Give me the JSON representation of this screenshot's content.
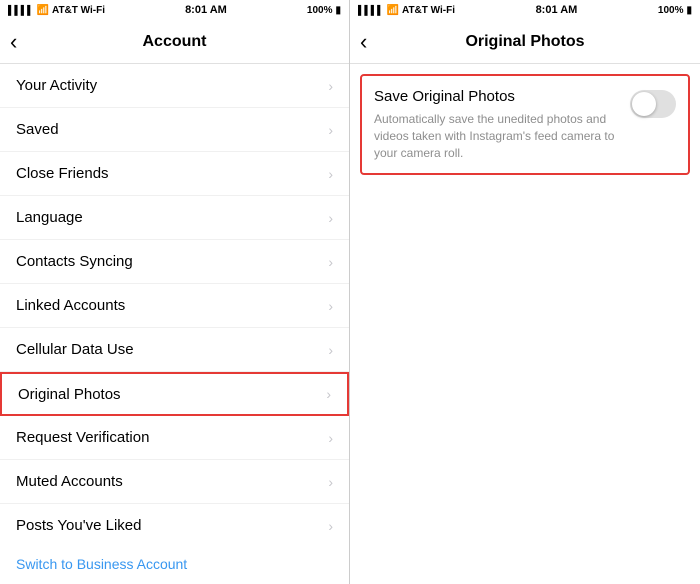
{
  "left": {
    "status": {
      "carrier": "AT&T Wi-Fi",
      "time": "8:01 AM",
      "battery": "100%"
    },
    "nav": {
      "back_label": "‹",
      "title": "Account"
    },
    "menu_items": [
      {
        "id": "your-activity",
        "label": "Your Activity",
        "highlighted": false
      },
      {
        "id": "saved",
        "label": "Saved",
        "highlighted": false
      },
      {
        "id": "close-friends",
        "label": "Close Friends",
        "highlighted": false
      },
      {
        "id": "language",
        "label": "Language",
        "highlighted": false
      },
      {
        "id": "contacts-syncing",
        "label": "Contacts Syncing",
        "highlighted": false
      },
      {
        "id": "linked-accounts",
        "label": "Linked Accounts",
        "highlighted": false
      },
      {
        "id": "cellular-data-use",
        "label": "Cellular Data Use",
        "highlighted": false
      },
      {
        "id": "original-photos",
        "label": "Original Photos",
        "highlighted": true
      },
      {
        "id": "request-verification",
        "label": "Request Verification",
        "highlighted": false
      },
      {
        "id": "muted-accounts",
        "label": "Muted Accounts",
        "highlighted": false
      },
      {
        "id": "posts-youve-liked",
        "label": "Posts You've Liked",
        "highlighted": false
      }
    ],
    "business_link": "Switch to Business Account"
  },
  "right": {
    "status": {
      "carrier": "AT&T Wi-Fi",
      "time": "8:01 AM",
      "battery": "100%"
    },
    "nav": {
      "back_label": "‹",
      "title": "Original Photos"
    },
    "setting": {
      "title": "Save Original Photos",
      "description": "Automatically save the unedited photos and videos taken with Instagram's feed camera to your camera roll.",
      "toggle_on": false
    }
  }
}
